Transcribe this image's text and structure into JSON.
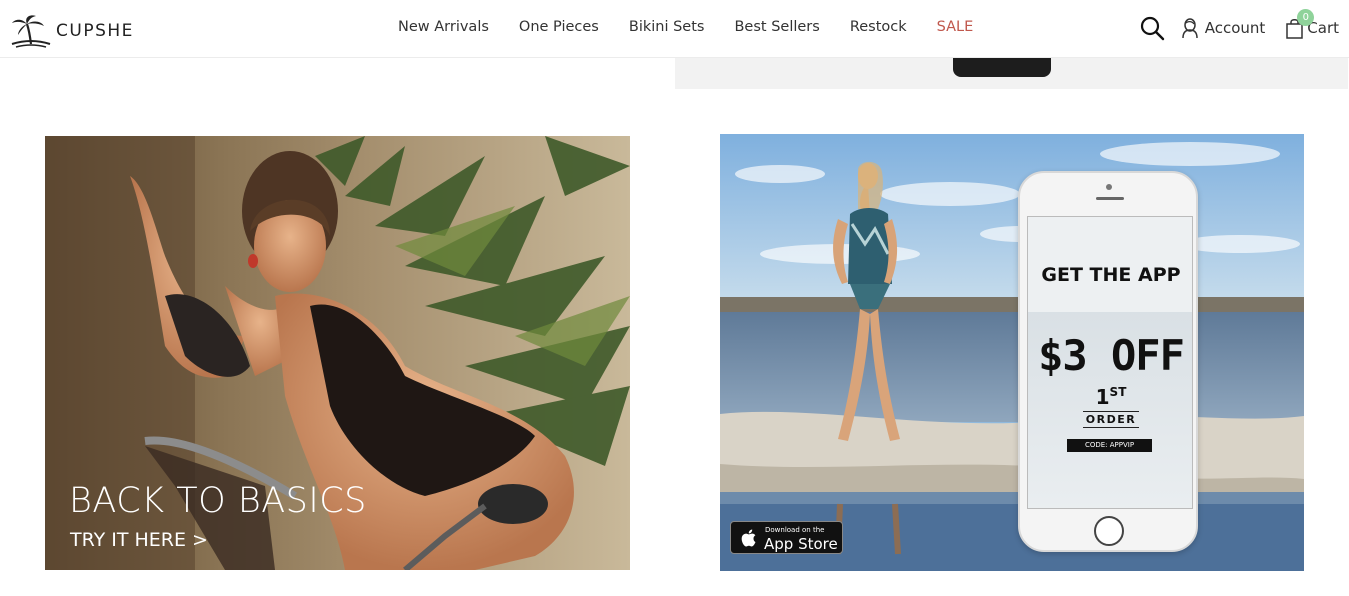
{
  "header": {
    "logo_text": "CUPSHE",
    "nav": [
      {
        "label": "New Arrivals"
      },
      {
        "label": "One Pieces"
      },
      {
        "label": "Bikini Sets"
      },
      {
        "label": "Best Sellers"
      },
      {
        "label": "Restock"
      },
      {
        "label": "SALE"
      }
    ],
    "account_label": "Account",
    "cart_label": "Cart",
    "cart_count": "0",
    "sale_color": "#c0584d",
    "badge_color": "#8fd39a",
    "icons": [
      "palm-logo-icon",
      "search-icon",
      "user-icon",
      "shopping-bag-icon"
    ]
  },
  "promos": {
    "left": {
      "headline": "BACK TO BASICS",
      "cta": "TRY IT HERE >"
    },
    "right": {
      "phone_title": "GET THE APP",
      "discount": "$3 OFF",
      "first_number": "1",
      "first_suffix": "ST",
      "order_label": "ORDER",
      "code_label": "CODE: APPVIP",
      "appstore_small": "Download on the",
      "appstore_big": "App Store"
    }
  }
}
